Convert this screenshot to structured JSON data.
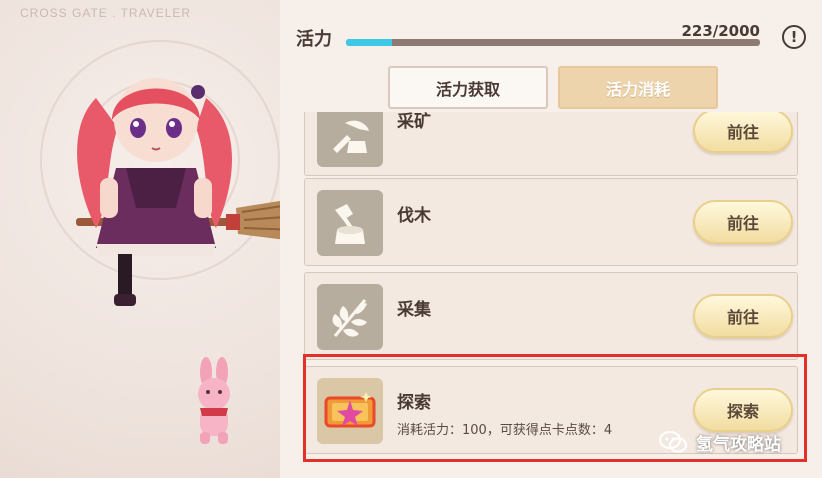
{
  "brand": {
    "text": "CROSS GATE . TRAVELER"
  },
  "vitality": {
    "label": "活力",
    "current": 223,
    "max": 2000,
    "value_text": "223/2000",
    "fill_fraction": 0.1115,
    "fill_color": "#3ec8e8"
  },
  "help": {
    "icon": "exclamation-icon",
    "glyph": "!"
  },
  "tabs": [
    {
      "label": "活力获取",
      "active": false
    },
    {
      "label": "活力消耗",
      "active": true
    }
  ],
  "activities": [
    {
      "title": "采矿",
      "icon": "mining-icon",
      "button": "前往"
    },
    {
      "title": "伐木",
      "icon": "axe-stump-icon",
      "button": "前往"
    },
    {
      "title": "采集",
      "icon": "leaf-icon",
      "button": "前往"
    },
    {
      "title": "探索",
      "icon": "ticket-icon",
      "description": "消耗活力：100，可获得点卡点数：4",
      "button": "探索"
    }
  ],
  "watermark": {
    "text": "氢气攻略站",
    "icon": "wechat-logo-icon"
  },
  "colors": {
    "accent": "#3ec8e8",
    "highlight_box": "#e2312b",
    "button_gold": "#f2dda1"
  }
}
